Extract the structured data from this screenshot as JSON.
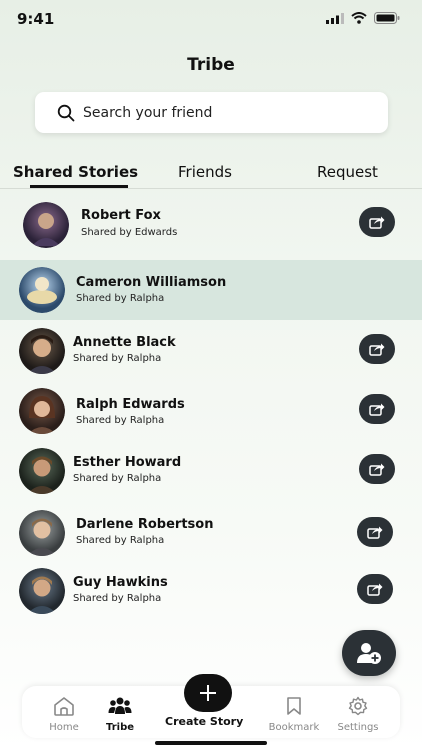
{
  "status": {
    "time": "9:41"
  },
  "header": {
    "title": "Tribe"
  },
  "search": {
    "placeholder": "Search your friend"
  },
  "tabs": [
    {
      "label": "Shared Stories",
      "active": true
    },
    {
      "label": "Friends",
      "active": false
    },
    {
      "label": "Request",
      "active": false
    }
  ],
  "stories": [
    {
      "name": "Robert Fox",
      "shared_by": "Shared by Edwards",
      "selected": false
    },
    {
      "name": "Cameron Williamson",
      "shared_by": "Shared by Ralpha",
      "selected": true
    },
    {
      "name": "Annette Black",
      "shared_by": "Shared by Ralpha",
      "selected": false
    },
    {
      "name": "Ralph Edwards",
      "shared_by": "Shared by Ralpha",
      "selected": false
    },
    {
      "name": "Esther Howard",
      "shared_by": "Shared by Ralpha",
      "selected": false
    },
    {
      "name": "Darlene Robertson",
      "shared_by": "Shared by Ralpha",
      "selected": false
    },
    {
      "name": "Guy Hawkins",
      "shared_by": "Shared by Ralpha",
      "selected": false
    }
  ],
  "fab": {
    "icon": "add-user-icon"
  },
  "bottom_nav": {
    "items": [
      {
        "label": "Home",
        "icon": "home-icon",
        "active": false
      },
      {
        "label": "Tribe",
        "icon": "people-icon",
        "active": true
      },
      {
        "label": "Bookmark",
        "icon": "bookmark-icon",
        "active": false
      },
      {
        "label": "Settings",
        "icon": "gear-icon",
        "active": false
      }
    ],
    "create_label": "Create Story"
  },
  "colors": {
    "accent": "#2b3136",
    "selected_row": "#d7e6de"
  }
}
